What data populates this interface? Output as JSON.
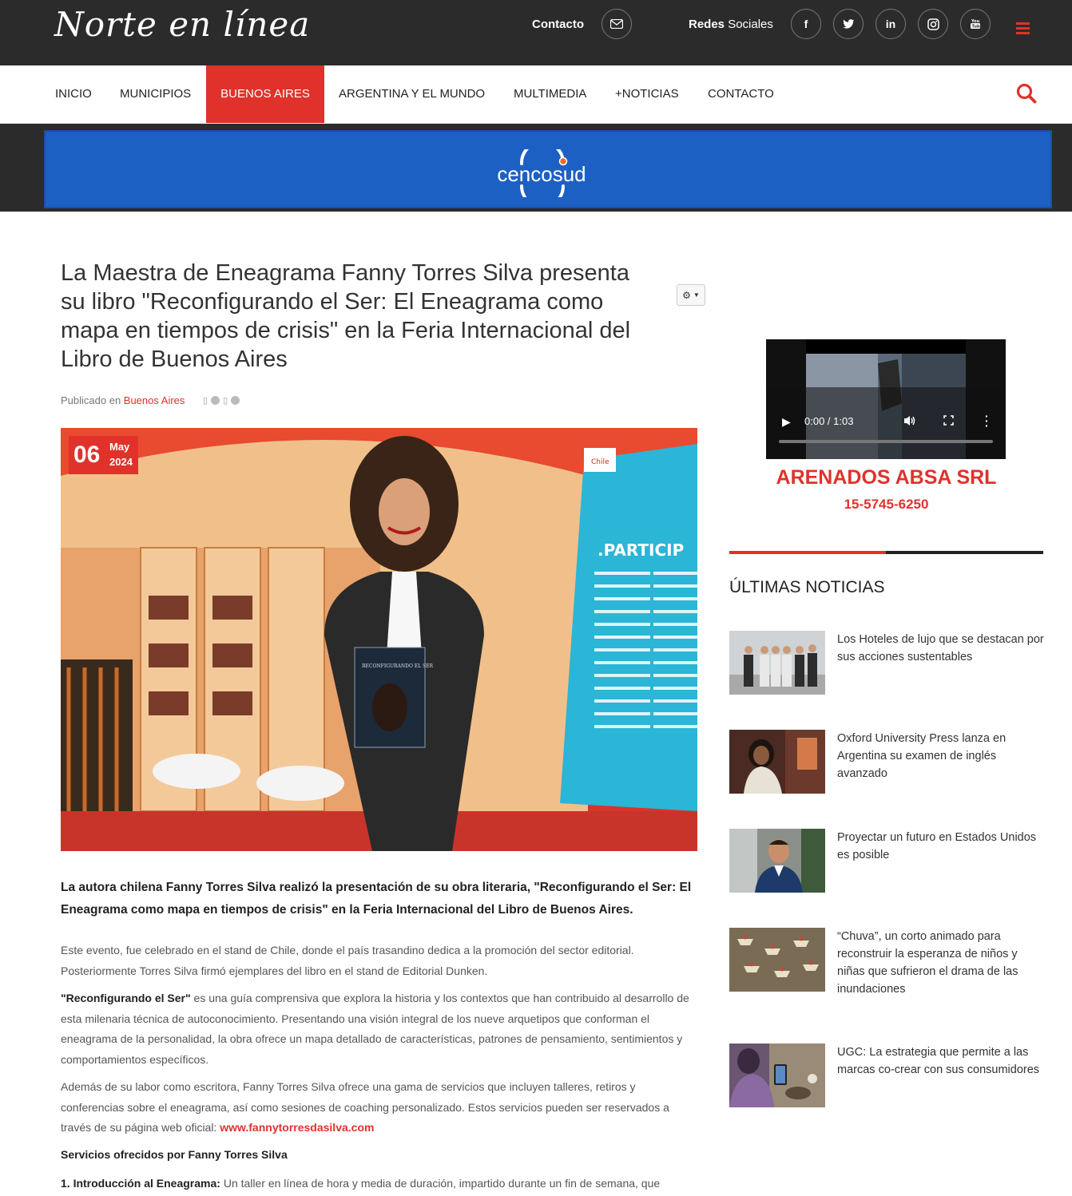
{
  "site": {
    "logo": "Norte en línea",
    "contact_label": "Contacto",
    "social_label_bold": "Redes",
    "social_label_rest": " Sociales",
    "social_icons": [
      "facebook",
      "twitter",
      "linkedin",
      "instagram",
      "youtube"
    ]
  },
  "nav": {
    "items": [
      {
        "label": "Inicio"
      },
      {
        "label": "Municipios"
      },
      {
        "label": "Buenos Aires"
      },
      {
        "label": "Argentina y el Mundo"
      },
      {
        "label": "Multimedia"
      },
      {
        "label": "+Noticias"
      },
      {
        "label": "Contacto"
      }
    ],
    "active": "Buenos Aires"
  },
  "banner": {
    "brand": "cencosud",
    "color": "#1d60c4"
  },
  "article": {
    "title": "La Maestra de Eneagrama Fanny Torres Silva presenta su libro \"Reconfigurando el Ser: El Eneagrama como mapa en tiempos de crisis\" en la Feria Internacional del Libro de Buenos Aires",
    "published_prefix": "Publicado en ",
    "category": "Buenos Aires",
    "date": {
      "day": "06",
      "month": "May",
      "year": "2024"
    },
    "lead": "La autora chilena Fanny Torres Silva realizó la presentación de su obra literaria, \"Reconfigurando el Ser: El Eneagrama como mapa en tiempos de crisis\" en la Feria Internacional del Libro de Buenos Aires.",
    "para1": "Este evento, fue celebrado en el stand de Chile, donde el país trasandino dedica a la promoción del sector editorial. Posteriormente Torres Silva firmó ejemplares del libro en el stand de Editorial Dunken.",
    "para2_bold": "\"Reconfigurando el Ser\"",
    "para2_rest": " es una guía comprensiva que explora la historia y los contextos que han contribuido al desarrollo de esta milenaria técnica de autoconocimiento. Presentando una visión integral de los nueve arquetipos que conforman el eneagrama de la personalidad, la obra ofrece un mapa detallado de características, patrones de pensamiento, sentimientos y comportamientos específicos.",
    "para3": "Además de su labor como escritora, Fanny Torres Silva ofrece una gama de servicios que incluyen talleres, retiros y conferencias sobre el eneagrama, así como sesiones de coaching personalizado. Estos servicios pueden ser reservados a través de su página web oficial: ",
    "para3_link": "www.fannytorresdasilva.com",
    "services_heading": "Servicios ofrecidos por Fanny Torres Silva",
    "service1_bold": "1. Introducción al Eneagrama:",
    "service1_rest": " Un taller en línea de hora y media de duración, impartido durante un fin de semana, que",
    "photo_texts": {
      "stand_heading": ".PARTICIP",
      "book_title": "RECONFIGURANDO EL SER",
      "flag": "Chile"
    }
  },
  "sidebar": {
    "video": {
      "time": "0:00 / 1:03",
      "progress": 0
    },
    "ad_title": "ARENADOS ABSA SRL",
    "ad_phone": "15-5745-6250",
    "section_title": "Últimas Noticias",
    "news": [
      {
        "title": "Los Hoteles de lujo que se destacan por sus acciones sustentables"
      },
      {
        "title": "Oxford University Press lanza en Argentina su examen de inglés avanzado"
      },
      {
        "title": "Proyectar un futuro en Estados Unidos es posible"
      },
      {
        "title": "“Chuva”, un corto animado para reconstruir la esperanza de niños y niñas que sufrieron el drama de las inundaciones"
      },
      {
        "title": "UGC: La estrategia que permite a las marcas co-crear con sus consumidores"
      }
    ]
  },
  "colors": {
    "accent": "#e0322b",
    "topbar": "#2b2b2b"
  }
}
